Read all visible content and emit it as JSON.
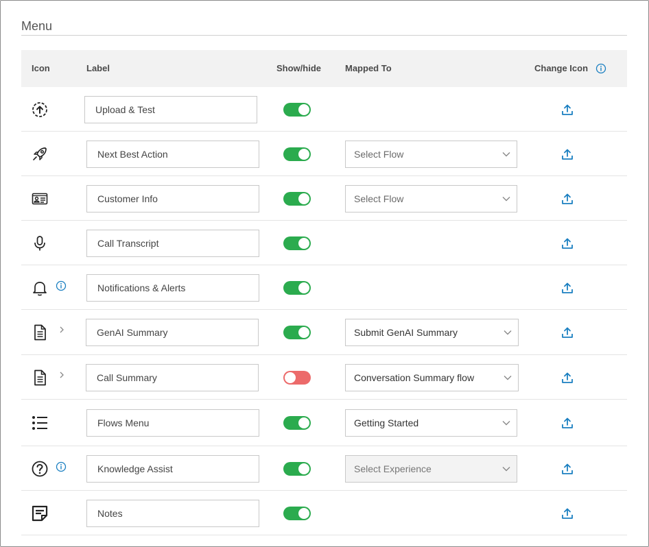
{
  "section": {
    "title": "Menu"
  },
  "header": {
    "icon": "Icon",
    "label": "Label",
    "show_hide": "Show/hide",
    "mapped_to": "Mapped To",
    "change_icon": "Change Icon",
    "info_icon": "info-icon"
  },
  "rows": [
    {
      "icon": "upload-circle-icon",
      "label": "Upload & Test",
      "visible": true,
      "mapped": null,
      "upload_icon": "upload-icon"
    },
    {
      "icon": "rocket-icon",
      "label": "Next Best Action",
      "visible": true,
      "mapped": "Select Flow",
      "mapped_is_placeholder": true,
      "upload_icon": "upload-icon"
    },
    {
      "icon": "id-card-icon",
      "label": "Customer Info",
      "visible": true,
      "mapped": "Select Flow",
      "mapped_is_placeholder": true,
      "upload_icon": "upload-icon"
    },
    {
      "icon": "microphone-icon",
      "label": "Call Transcript",
      "visible": true,
      "mapped": null,
      "upload_icon": "upload-icon"
    },
    {
      "icon": "bell-icon",
      "label": "Notifications & Alerts",
      "visible": true,
      "mapped": null,
      "has_info": true,
      "upload_icon": "upload-icon"
    },
    {
      "icon": "document-icon",
      "label": "GenAI Summary",
      "visible": true,
      "mapped": "Submit GenAI Summary",
      "has_chevron": true,
      "upload_icon": "upload-icon"
    },
    {
      "icon": "document-icon",
      "label": "Call Summary",
      "visible": false,
      "mapped": "Conversation Summary flow",
      "has_chevron": true,
      "upload_icon": "upload-icon"
    },
    {
      "icon": "list-icon",
      "label": "Flows Menu",
      "visible": true,
      "mapped": "Getting Started",
      "upload_icon": "upload-icon"
    },
    {
      "icon": "question-circle-icon",
      "label": "Knowledge Assist",
      "visible": true,
      "mapped": "Select Experience",
      "mapped_is_placeholder": true,
      "mapped_disabled": true,
      "has_info": true,
      "upload_icon": "upload-icon"
    },
    {
      "icon": "note-icon",
      "label": "Notes",
      "visible": true,
      "mapped": null,
      "upload_icon": "upload-icon"
    }
  ],
  "colors": {
    "toggle_on": "#2bab4e",
    "toggle_off": "#ec6a6a",
    "accent": "#1a7fc1"
  }
}
